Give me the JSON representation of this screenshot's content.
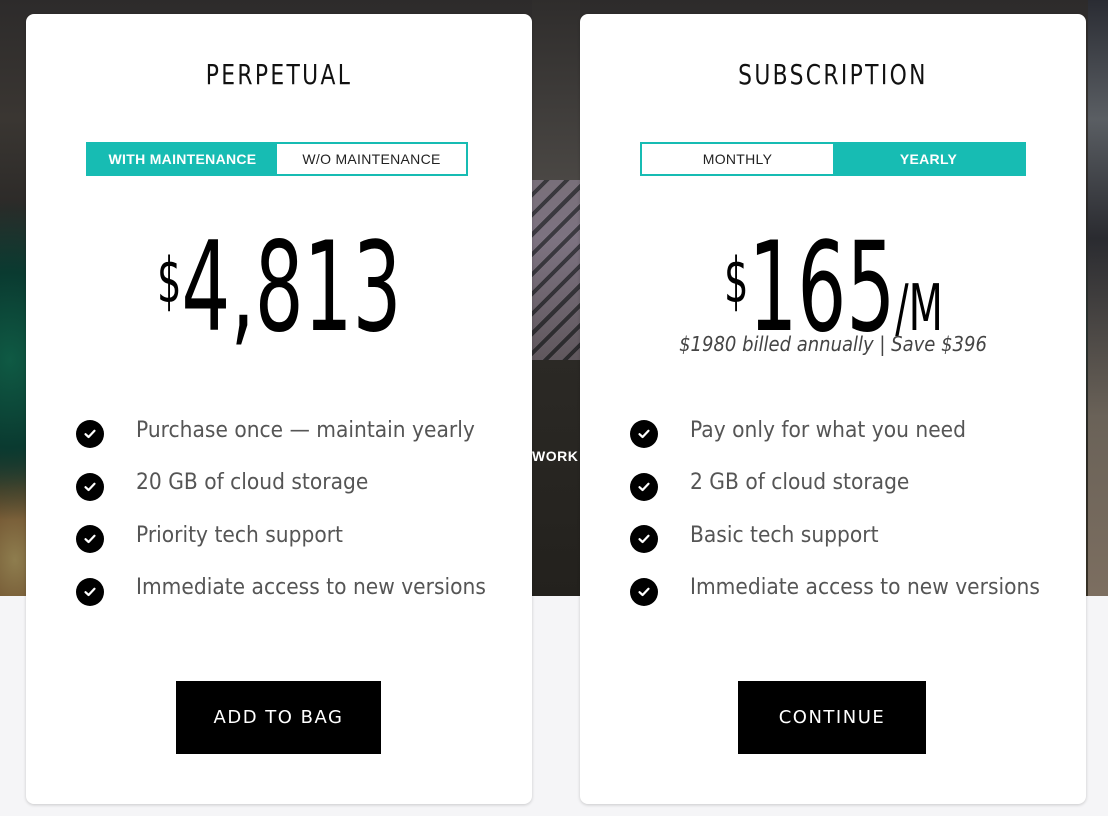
{
  "background": {
    "partial_text": "WORKS"
  },
  "colors": {
    "accent": "#17bcb3",
    "button_bg": "#000000",
    "card_bg": "#ffffff",
    "page_bg": "#f5f5f7"
  },
  "plans": [
    {
      "title": "PERPETUAL",
      "toggle": {
        "options": [
          "WITH MAINTENANCE",
          "W/O MAINTENANCE"
        ],
        "selected": "WITH MAINTENANCE"
      },
      "price": {
        "currency": "$",
        "amount": "4,813",
        "period": ""
      },
      "billing_note": "",
      "features": [
        "Purchase once — maintain yearly",
        "20 GB of cloud storage",
        "Priority tech support",
        "Immediate access to new versions"
      ],
      "feature_icon": "check-circle-icon",
      "cta_label": "ADD TO BAG"
    },
    {
      "title": "SUBSCRIPTION",
      "toggle": {
        "options": [
          "MONTHLY",
          "YEARLY"
        ],
        "selected": "YEARLY"
      },
      "price": {
        "currency": "$",
        "amount": "165",
        "period": "/M"
      },
      "billing_note": "$1980 billed annually | Save $396",
      "features": [
        "Pay only for what you need",
        "2 GB of cloud storage",
        "Basic tech support",
        "Immediate access to new versions"
      ],
      "feature_icon": "check-circle-icon",
      "cta_label": "CONTINUE"
    }
  ]
}
